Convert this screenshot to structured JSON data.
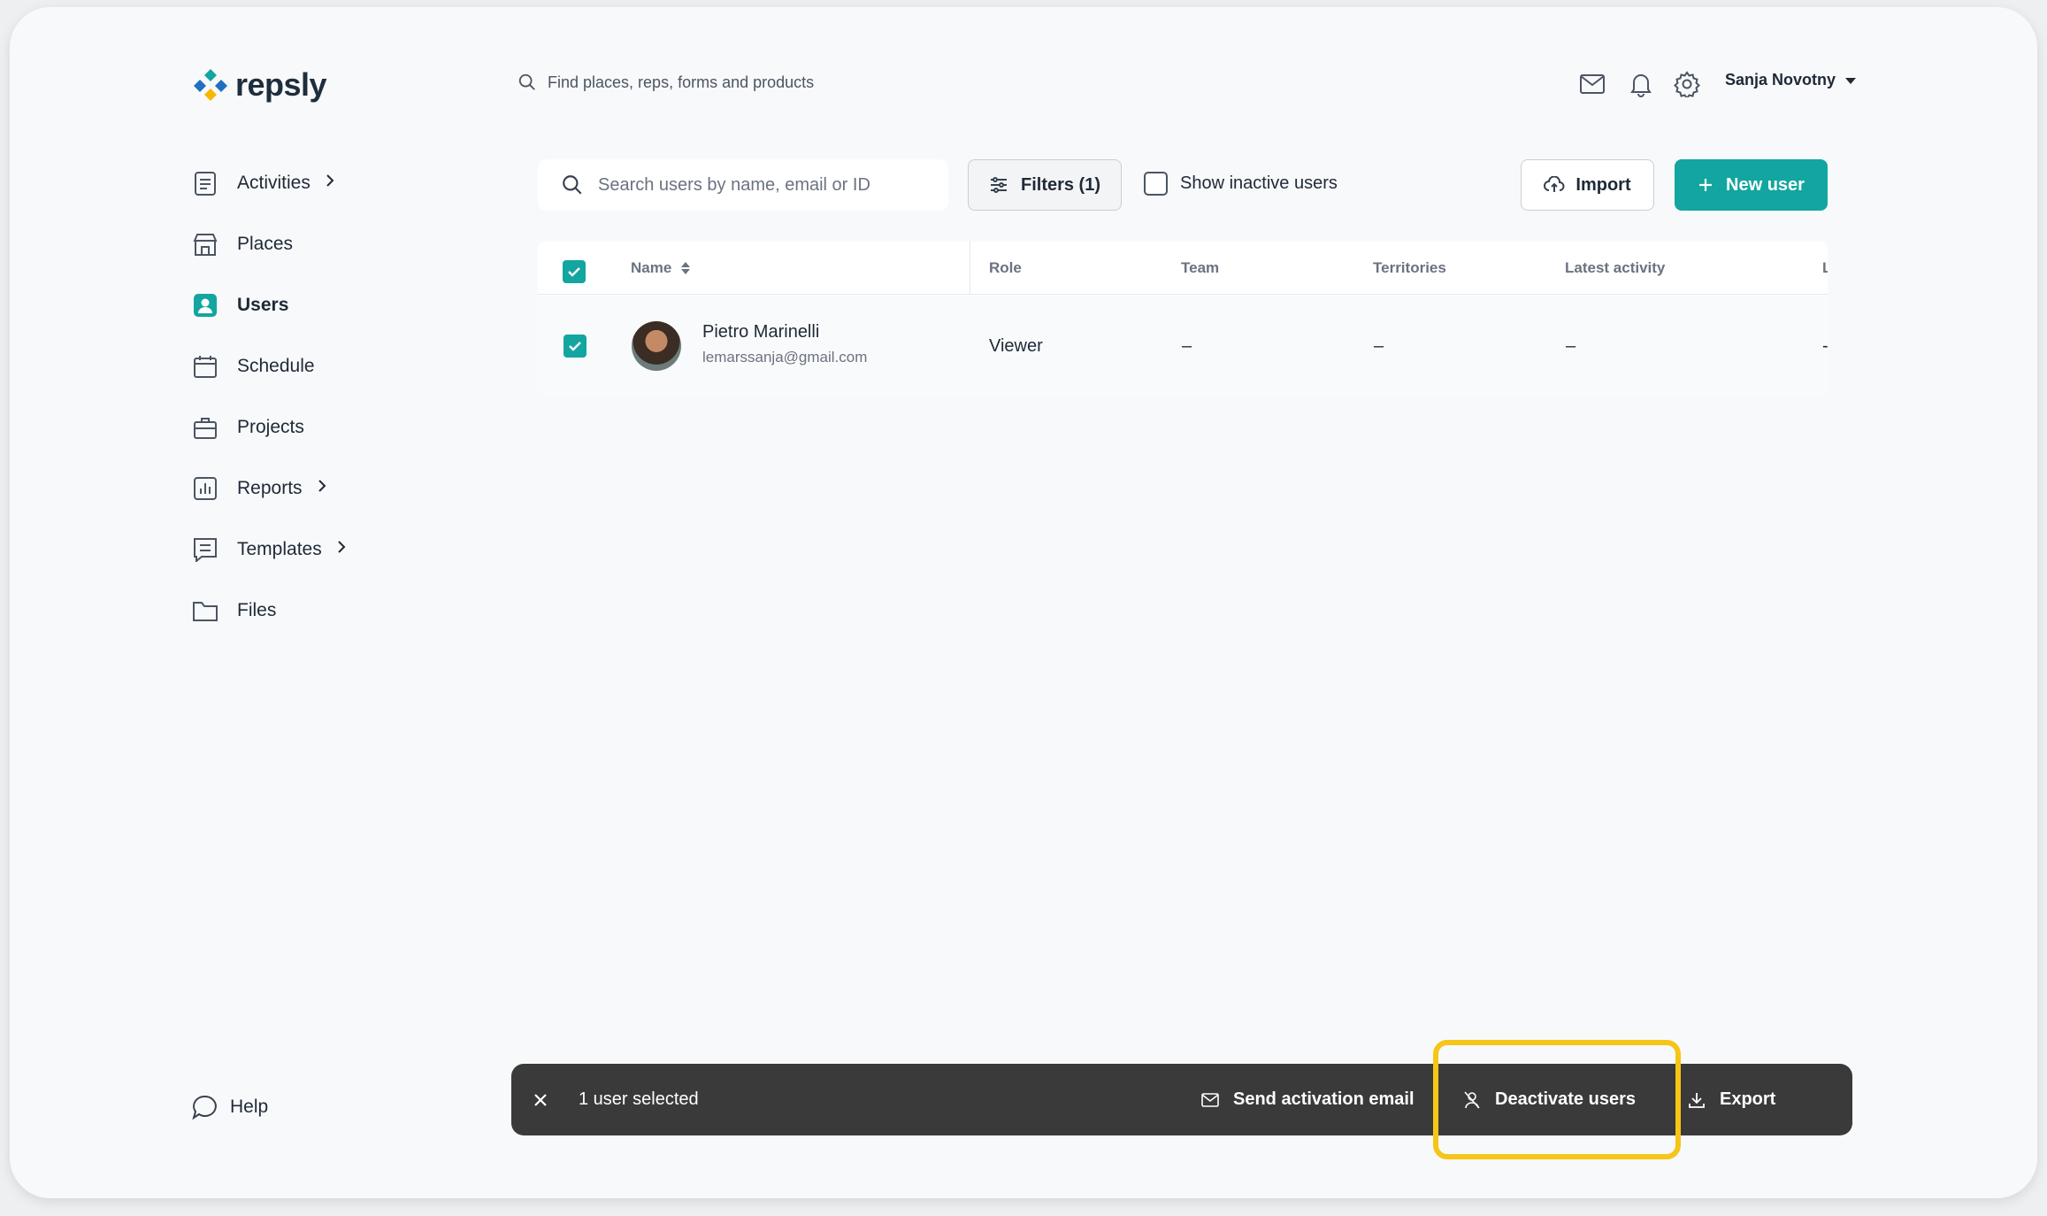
{
  "brand": {
    "name": "repsly"
  },
  "global_search": {
    "placeholder": "Find places, reps, forms and products"
  },
  "header": {
    "user_name": "Sanja Novotny"
  },
  "sidebar": {
    "items": [
      {
        "label": "Activities",
        "icon": "activities-icon",
        "has_submenu": true
      },
      {
        "label": "Places",
        "icon": "store-icon",
        "has_submenu": false
      },
      {
        "label": "Users",
        "icon": "user-icon",
        "has_submenu": false,
        "active": true
      },
      {
        "label": "Schedule",
        "icon": "calendar-icon",
        "has_submenu": false
      },
      {
        "label": "Projects",
        "icon": "briefcase-icon",
        "has_submenu": false
      },
      {
        "label": "Reports",
        "icon": "report-chart-icon",
        "has_submenu": true
      },
      {
        "label": "Templates",
        "icon": "template-icon",
        "has_submenu": true
      },
      {
        "label": "Files",
        "icon": "folder-icon",
        "has_submenu": false
      }
    ],
    "help_label": "Help"
  },
  "toolbar": {
    "search_placeholder": "Search users by name, email or ID",
    "filters_label": "Filters (1)",
    "show_inactive_label": "Show inactive users",
    "import_label": "Import",
    "new_user_label": "New user"
  },
  "table": {
    "columns": [
      "Name",
      "Role",
      "Team",
      "Territories",
      "Latest activity",
      "L"
    ],
    "rows": [
      {
        "name": "Pietro Marinelli",
        "email": "lemarssanja@gmail.com",
        "role": "Viewer",
        "team": "–",
        "territories": "–",
        "latest_activity": "–",
        "extra": "-",
        "selected": true
      }
    ]
  },
  "action_bar": {
    "selected_text": "1 user selected",
    "send_activation_label": "Send activation email",
    "deactivate_label": "Deactivate users",
    "export_label": "Export"
  },
  "colors": {
    "accent": "#13a5a0",
    "highlight": "#f5c518",
    "action_bar": "#3a3a3a"
  }
}
